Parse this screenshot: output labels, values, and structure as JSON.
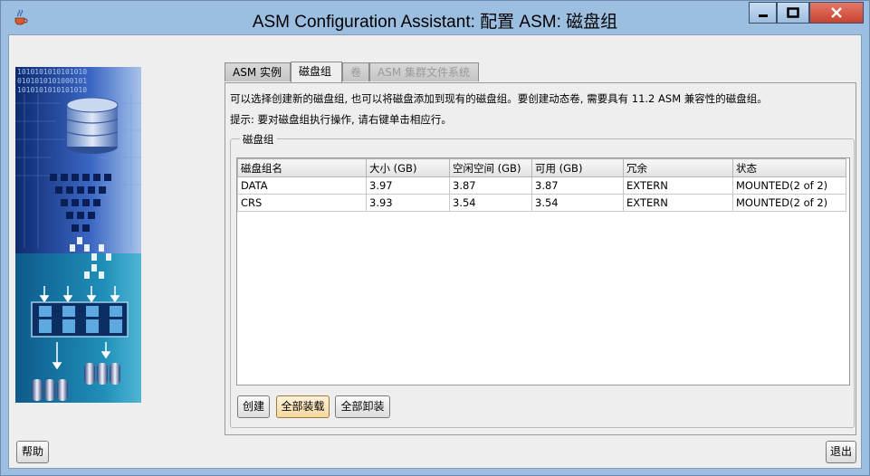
{
  "window": {
    "title": "ASM Configuration Assistant: 配置 ASM: 磁盘组",
    "controls": {
      "minimize": "minimize",
      "maximize": "maximize",
      "close": "close"
    }
  },
  "side_image": {
    "binary_rows": [
      "1010101010101010",
      "0101010101000101",
      "1010101010101010"
    ]
  },
  "tabs": [
    {
      "label": "ASM 实例",
      "state": "normal"
    },
    {
      "label": "磁盘组",
      "state": "active"
    },
    {
      "label": "卷",
      "state": "disabled"
    },
    {
      "label": "ASM 集群文件系统",
      "state": "disabled"
    }
  ],
  "info": {
    "line1": "可以选择创建新的磁盘组, 也可以将磁盘添加到现有的磁盘组。要创建动态卷, 需要具有 11.2 ASM 兼容性的磁盘组。",
    "line2": "提示: 要对磁盘组执行操作, 请右键单击相应行。"
  },
  "group": {
    "legend": "磁盘组"
  },
  "table": {
    "columns": [
      "磁盘组名",
      "大小 (GB)",
      "空闲空间 (GB)",
      "可用 (GB)",
      "冗余",
      "状态"
    ],
    "rows": [
      [
        "DATA",
        "3.97",
        "3.87",
        "3.87",
        "EXTERN",
        "MOUNTED(2 of 2)"
      ],
      [
        "CRS",
        "3.93",
        "3.54",
        "3.54",
        "EXTERN",
        "MOUNTED(2 of 2)"
      ]
    ]
  },
  "buttons": {
    "create": "创建",
    "mount_all": "全部装载",
    "unmount_all": "全部卸装",
    "help": "帮助",
    "exit": "退出"
  },
  "colors": {
    "title_bar": "#9cbfe1",
    "close_button": "#c7432f",
    "panel_bg": "#eeeeee",
    "image_blue": "#1b3d8a"
  }
}
